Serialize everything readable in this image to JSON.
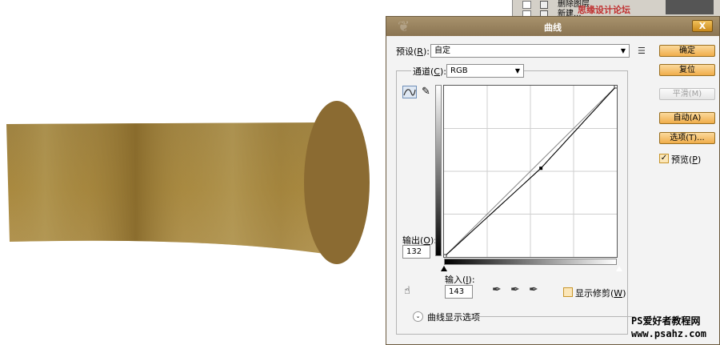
{
  "layers_panel": {
    "row1_label": "删除图层",
    "row2_label": "新建..."
  },
  "watermark": "思缘设计论坛 WWW.MISSYUAN.COM",
  "dialog": {
    "title": "曲线",
    "close_label": "X",
    "preset": {
      "label": "预设(",
      "key": "R",
      "label_end": "):",
      "value": "自定"
    },
    "channel": {
      "label": "通道(",
      "key": "C",
      "label_end": "):",
      "value": "RGB"
    },
    "output": {
      "label": "输出(",
      "key": "O",
      "label_end": "):",
      "value": "132"
    },
    "input": {
      "label": "输入(",
      "key": "I",
      "label_end": "):",
      "value": "143"
    },
    "show_clipping": {
      "label": "显示修剪(",
      "key": "W",
      "label_end": ")",
      "checked": false
    },
    "curve_display_options": "曲线显示选项",
    "buttons": {
      "ok": "确定",
      "reset": "复位",
      "smooth": "平滑(M)",
      "auto": "自动(A)",
      "options": "选项(T)..."
    },
    "preview": {
      "label": "预览(",
      "key": "P",
      "label_end": ")",
      "checked": true
    },
    "curve_point": {
      "input": 143,
      "output": 132
    }
  },
  "site_logo": {
    "line1": "PS爱好者教程网",
    "line2": "www.psahz.com"
  },
  "colors": {
    "dialog_title": "#8a7452",
    "button": "#f0ad4a",
    "artwork_gold": "#a5843e",
    "artwork_end": "#8b6b32"
  }
}
